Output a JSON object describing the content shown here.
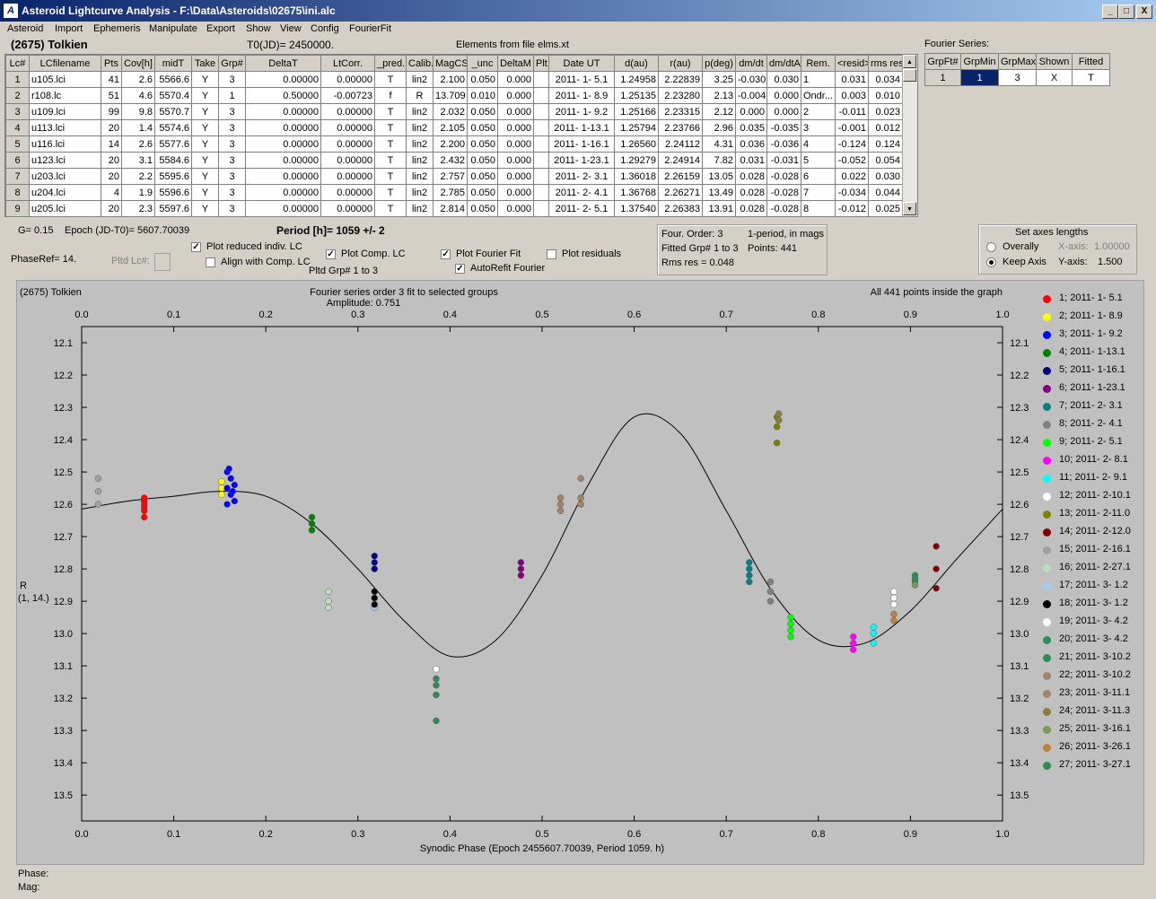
{
  "window": {
    "title": "Asteroid Lightcurve Analysis - F:\\Data\\Asteroids\\02675\\ini.alc",
    "icon": "A",
    "min": "_",
    "max": "□",
    "close": "X"
  },
  "menu": [
    "Asteroid",
    "Import",
    "Ephemeris",
    "Manipulate",
    "Export",
    "Show",
    "View",
    "Config",
    "FourierFit"
  ],
  "header": {
    "asteroid": "(2675) Tolkien",
    "t0": "T0(JD)= 2450000.",
    "elements": "Elements from file elms.xt"
  },
  "lc_table": {
    "headers": [
      "Lc#",
      "LCfilename",
      "Pts",
      "Cov[h]",
      "midT",
      "Take",
      "Grp#",
      "DeltaT",
      "LtCorr.",
      "_pred.",
      "Calib.",
      "MagCS",
      "_unc",
      "DeltaM",
      "Plt",
      "Date UT",
      "d(au)",
      "r(au)",
      "p(deg)",
      "dm/dt",
      "dm/dtA",
      "Rem.",
      "<resid>",
      "rms res"
    ],
    "rows": [
      [
        "1",
        "u105.lci",
        "41",
        "2.6",
        "5566.6",
        "Y",
        "3",
        "0.00000",
        "0.00000",
        "T",
        "lin2",
        "2.100",
        "0.050",
        "0.000",
        "",
        "2011- 1- 5.1",
        "1.24958",
        "2.22839",
        "3.25",
        "-0.030",
        "0.030",
        "1",
        "0.031",
        "0.034"
      ],
      [
        "2",
        "r108.lc",
        "51",
        "4.6",
        "5570.4",
        "Y",
        "1",
        "0.50000",
        "-0.00723",
        "f",
        "R",
        "13.709",
        "0.010",
        "0.000",
        "",
        "2011- 1- 8.9",
        "1.25135",
        "2.23280",
        "2.13",
        "-0.004",
        "0.000",
        "Ondr...",
        "0.003",
        "0.010"
      ],
      [
        "3",
        "u109.lci",
        "99",
        "9.8",
        "5570.7",
        "Y",
        "3",
        "0.00000",
        "0.00000",
        "T",
        "lin2",
        "2.032",
        "0.050",
        "0.000",
        "",
        "2011- 1- 9.2",
        "1.25166",
        "2.23315",
        "2.12",
        "0.000",
        "0.000",
        "2",
        "-0.011",
        "0.023"
      ],
      [
        "4",
        "u113.lci",
        "20",
        "1.4",
        "5574.6",
        "Y",
        "3",
        "0.00000",
        "0.00000",
        "T",
        "lin2",
        "2.105",
        "0.050",
        "0.000",
        "",
        "2011- 1-13.1",
        "1.25794",
        "2.23766",
        "2.96",
        "0.035",
        "-0.035",
        "3",
        "-0.001",
        "0.012"
      ],
      [
        "5",
        "u116.lci",
        "14",
        "2.6",
        "5577.6",
        "Y",
        "3",
        "0.00000",
        "0.00000",
        "T",
        "lin2",
        "2.200",
        "0.050",
        "0.000",
        "",
        "2011- 1-16.1",
        "1.26560",
        "2.24112",
        "4.31",
        "0.036",
        "-0.036",
        "4",
        "-0.124",
        "0.124"
      ],
      [
        "6",
        "u123.lci",
        "20",
        "3.1",
        "5584.6",
        "Y",
        "3",
        "0.00000",
        "0.00000",
        "T",
        "lin2",
        "2.432",
        "0.050",
        "0.000",
        "",
        "2011- 1-23.1",
        "1.29279",
        "2.24914",
        "7.82",
        "0.031",
        "-0.031",
        "5",
        "-0.052",
        "0.054"
      ],
      [
        "7",
        "u203.lci",
        "20",
        "2.2",
        "5595.6",
        "Y",
        "3",
        "0.00000",
        "0.00000",
        "T",
        "lin2",
        "2.757",
        "0.050",
        "0.000",
        "",
        "2011- 2- 3.1",
        "1.36018",
        "2.26159",
        "13.05",
        "0.028",
        "-0.028",
        "6",
        "0.022",
        "0.030"
      ],
      [
        "8",
        "u204.lci",
        "4",
        "1.9",
        "5596.6",
        "Y",
        "3",
        "0.00000",
        "0.00000",
        "T",
        "lin2",
        "2.785",
        "0.050",
        "0.000",
        "",
        "2011- 2- 4.1",
        "1.36768",
        "2.26271",
        "13.49",
        "0.028",
        "-0.028",
        "7",
        "-0.034",
        "0.044"
      ],
      [
        "9",
        "u205.lci",
        "20",
        "2.3",
        "5597.6",
        "Y",
        "3",
        "0.00000",
        "0.00000",
        "T",
        "lin2",
        "2.814",
        "0.050",
        "0.000",
        "",
        "2011- 2- 5.1",
        "1.37540",
        "2.26383",
        "13.91",
        "0.028",
        "-0.028",
        "8",
        "-0.012",
        "0.025"
      ]
    ]
  },
  "fourier_table": {
    "caption": "Fourier Series:",
    "headers": [
      "GrpFt#",
      "GrpMin",
      "GrpMax",
      "Shown",
      "Fitted"
    ],
    "row": [
      "1",
      "1",
      "3",
      "X",
      "T"
    ]
  },
  "params": {
    "g": "G= 0.15",
    "epoch": "Epoch (JD-T0)= 5607.70039",
    "period": "Period [h]= 1059 +/- 2",
    "phaseref": "PhaseRef= 14.",
    "pltd_lc": "Pltd Lc#:",
    "plot_reduced": "Plot reduced indiv. LC",
    "align": "Align with Comp. LC",
    "plot_comp": "Plot Comp. LC",
    "pltd_grp": "Pltd Grp#  1   to   3",
    "plot_fourier": "Plot Fourier Fit",
    "autorefit": "AutoRefit Fourier",
    "plot_resid": "Plot residuals",
    "check": "✓"
  },
  "fit_info": {
    "order": "Four. Order:  3",
    "period_type": "1-period, in mags",
    "fitted": "Fitted Grp# 1 to 3",
    "points": "Points: 441",
    "rms": "Rms res     = 0.048"
  },
  "axes_box": {
    "title": "Set axes lengths",
    "overally": "Overally",
    "keep": "Keep Axis",
    "xaxis": "X-axis:",
    "xval": "1.00000",
    "yaxis": "Y-axis:",
    "yval": "1.500",
    "selected": "Keep Axis"
  },
  "status": {
    "phase": "Phase:",
    "mag": "Mag:"
  },
  "chart_data": {
    "type": "scatter",
    "title": "(2675) Tolkien",
    "subtitle": "Fourier series order 3 fit to selected groups",
    "amplitude": "Amplitude: 0.751",
    "note": "All 441 points inside the graph",
    "xlabel": "Synodic Phase (Epoch 2455607.70039, Period 1059. h)",
    "ylabel": "R",
    "ylabel2": "(1, 14.)",
    "xlim": [
      0,
      1
    ],
    "ylim": [
      13.58,
      12.05
    ],
    "y_inverted": true,
    "xticks": [
      "0.0",
      "0.1",
      "0.2",
      "0.3",
      "0.4",
      "0.5",
      "0.6",
      "0.7",
      "0.8",
      "0.9",
      "1.0"
    ],
    "yticks": [
      "12.1",
      "12.2",
      "12.3",
      "12.4",
      "12.5",
      "12.6",
      "12.7",
      "12.8",
      "12.9",
      "13.0",
      "13.1",
      "13.2",
      "13.3",
      "13.4",
      "13.5"
    ],
    "fit_curve": [
      [
        0,
        12.615
      ],
      [
        0.05,
        12.59
      ],
      [
        0.1,
        12.575
      ],
      [
        0.15,
        12.56
      ],
      [
        0.2,
        12.575
      ],
      [
        0.25,
        12.66
      ],
      [
        0.3,
        12.8
      ],
      [
        0.35,
        12.96
      ],
      [
        0.4,
        13.07
      ],
      [
        0.45,
        13.02
      ],
      [
        0.5,
        12.82
      ],
      [
        0.55,
        12.54
      ],
      [
        0.6,
        12.33
      ],
      [
        0.65,
        12.38
      ],
      [
        0.7,
        12.62
      ],
      [
        0.75,
        12.87
      ],
      [
        0.8,
        13.02
      ],
      [
        0.85,
        13.03
      ],
      [
        0.9,
        12.93
      ],
      [
        0.95,
        12.77
      ],
      [
        1.0,
        12.615
      ]
    ],
    "series": [
      {
        "name": "1; 2011- 1- 5.1",
        "color": "#ff0000",
        "points": [
          [
            0.068,
            12.58
          ],
          [
            0.068,
            12.6
          ],
          [
            0.068,
            12.62
          ],
          [
            0.068,
            12.64
          ],
          [
            0.068,
            12.59
          ],
          [
            0.068,
            12.61
          ]
        ]
      },
      {
        "name": "2; 2011- 1- 8.9",
        "color": "#ffff00",
        "points": [
          [
            0.152,
            12.55
          ],
          [
            0.152,
            12.57
          ],
          [
            0.152,
            12.53
          ]
        ]
      },
      {
        "name": "3; 2011- 1- 9.2",
        "color": "#0000ff",
        "points": [
          [
            0.158,
            12.5
          ],
          [
            0.158,
            12.55
          ],
          [
            0.158,
            12.6
          ],
          [
            0.162,
            12.52
          ],
          [
            0.162,
            12.57
          ],
          [
            0.166,
            12.54
          ],
          [
            0.166,
            12.59
          ],
          [
            0.16,
            12.49
          ],
          [
            0.164,
            12.56
          ]
        ]
      },
      {
        "name": "4; 2011- 1-13.1",
        "color": "#008000",
        "points": [
          [
            0.25,
            12.64
          ],
          [
            0.25,
            12.66
          ],
          [
            0.25,
            12.68
          ]
        ]
      },
      {
        "name": "5; 2011- 1-16.1",
        "color": "#000080",
        "points": [
          [
            0.318,
            12.76
          ],
          [
            0.318,
            12.78
          ],
          [
            0.318,
            12.8
          ]
        ]
      },
      {
        "name": "6; 2011- 1-23.1",
        "color": "#800080",
        "points": [
          [
            0.477,
            12.78
          ],
          [
            0.477,
            12.8
          ],
          [
            0.477,
            12.82
          ]
        ]
      },
      {
        "name": "7; 2011- 2- 3.1",
        "color": "#008080",
        "points": [
          [
            0.725,
            12.78
          ],
          [
            0.725,
            12.8
          ],
          [
            0.725,
            12.82
          ],
          [
            0.725,
            12.84
          ]
        ]
      },
      {
        "name": "8; 2011- 2- 4.1",
        "color": "#808080",
        "points": [
          [
            0.748,
            12.84
          ],
          [
            0.748,
            12.87
          ],
          [
            0.748,
            12.9
          ]
        ]
      },
      {
        "name": "9; 2011- 2- 5.1",
        "color": "#00ff00",
        "points": [
          [
            0.77,
            12.95
          ],
          [
            0.77,
            12.97
          ],
          [
            0.77,
            12.99
          ],
          [
            0.77,
            13.01
          ]
        ]
      },
      {
        "name": "10; 2011- 2- 8.1",
        "color": "#ff00ff",
        "points": [
          [
            0.838,
            13.01
          ],
          [
            0.838,
            13.03
          ],
          [
            0.838,
            13.05
          ]
        ]
      },
      {
        "name": "11; 2011- 2- 9.1",
        "color": "#00ffff",
        "points": [
          [
            0.86,
            12.98
          ],
          [
            0.86,
            13.0
          ],
          [
            0.86,
            13.03
          ]
        ]
      },
      {
        "name": "12; 2011- 2-10.1",
        "color": "#ffffff",
        "points": [
          [
            0.882,
            12.87
          ],
          [
            0.882,
            12.89
          ],
          [
            0.882,
            12.91
          ]
        ]
      },
      {
        "name": "13; 2011- 2-11.0",
        "color": "#808000",
        "points": [
          [
            0.755,
            12.33
          ],
          [
            0.755,
            12.36
          ],
          [
            0.755,
            12.41
          ]
        ]
      },
      {
        "name": "14; 2011- 2-12.0",
        "color": "#800000",
        "points": [
          [
            0.928,
            12.73
          ],
          [
            0.928,
            12.8
          ],
          [
            0.928,
            12.86
          ]
        ]
      },
      {
        "name": "15; 2011- 2-16.1",
        "color": "#a0a0a0",
        "points": [
          [
            0.018,
            12.52
          ],
          [
            0.018,
            12.56
          ],
          [
            0.018,
            12.6
          ]
        ]
      },
      {
        "name": "16; 2011- 2-27.1",
        "color": "#c0dcc0",
        "points": [
          [
            0.268,
            12.87
          ],
          [
            0.268,
            12.9
          ],
          [
            0.268,
            12.92
          ]
        ]
      },
      {
        "name": "17; 2011- 3- 1.2",
        "color": "#a6caf0",
        "points": [
          [
            0.318,
            12.92
          ]
        ]
      },
      {
        "name": "18; 2011- 3- 1.2",
        "color": "#000000",
        "points": [
          [
            0.318,
            12.87
          ],
          [
            0.318,
            12.89
          ],
          [
            0.318,
            12.91
          ]
        ]
      },
      {
        "name": "19; 2011- 3- 4.2",
        "color": "#ffffff",
        "points": [
          [
            0.385,
            13.11
          ]
        ]
      },
      {
        "name": "20; 2011- 3- 4.2",
        "color": "#2e8b57",
        "points": [
          [
            0.385,
            13.14
          ],
          [
            0.385,
            13.16
          ],
          [
            0.385,
            13.19
          ],
          [
            0.385,
            13.27
          ]
        ]
      },
      {
        "name": "21; 2011- 3-10.2",
        "color": "#2e8b57",
        "points": [
          [
            0.905,
            12.82
          ],
          [
            0.905,
            12.84
          ]
        ]
      },
      {
        "name": "22; 2011- 3-10.2",
        "color": "#a0826d",
        "points": [
          [
            0.52,
            12.58
          ],
          [
            0.52,
            12.6
          ],
          [
            0.52,
            12.62
          ]
        ]
      },
      {
        "name": "23; 2011- 3-11.1",
        "color": "#a0826d",
        "points": [
          [
            0.542,
            12.52
          ],
          [
            0.542,
            12.58
          ],
          [
            0.542,
            12.6
          ]
        ]
      },
      {
        "name": "24; 2011- 3-11.3",
        "color": "#8b7d3a",
        "points": [
          [
            0.757,
            12.32
          ],
          [
            0.757,
            12.34
          ]
        ]
      },
      {
        "name": "25; 2011- 3-16.1",
        "color": "#7a9a5a",
        "points": [
          [
            0.905,
            12.85
          ]
        ]
      },
      {
        "name": "26; 2011- 3-26.1",
        "color": "#c08040",
        "points": [
          [
            0.882,
            12.94
          ],
          [
            0.882,
            12.96
          ]
        ]
      },
      {
        "name": "27; 2011- 3-27.1",
        "color": "#2e8b57",
        "points": [
          [
            0.905,
            12.83
          ]
        ]
      }
    ]
  }
}
